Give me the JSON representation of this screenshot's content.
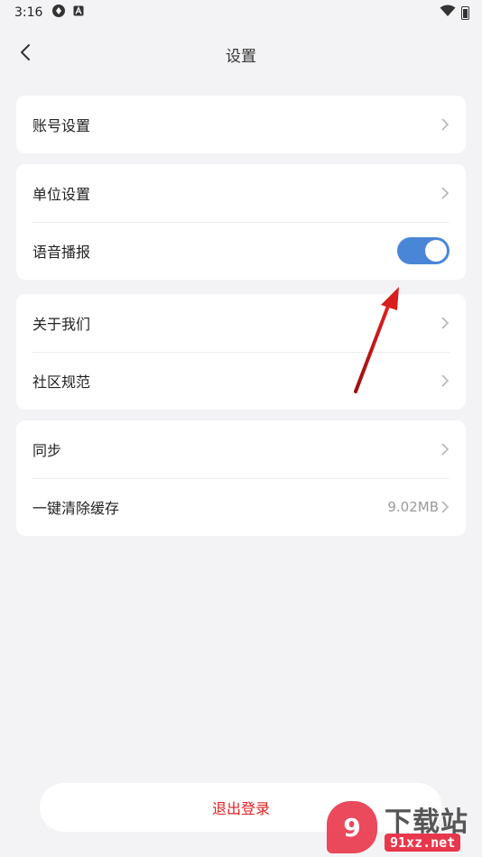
{
  "status_bar": {
    "time": "3:16"
  },
  "nav": {
    "title": "设置"
  },
  "groups": [
    {
      "items": [
        {
          "label": "账号设置"
        }
      ]
    },
    {
      "items": [
        {
          "label": "单位设置"
        },
        {
          "label": "语音播报",
          "toggle_on": true
        }
      ]
    },
    {
      "items": [
        {
          "label": "关于我们"
        },
        {
          "label": "社区规范"
        }
      ]
    },
    {
      "items": [
        {
          "label": "同步"
        },
        {
          "label": "一键清除缓存",
          "value": "9.02MB"
        }
      ]
    }
  ],
  "logout": {
    "label": "退出登录"
  },
  "watermark": {
    "badge": "9",
    "title": "下载站",
    "sub": "91xz.net"
  },
  "colors": {
    "accent": "#4a86d8",
    "danger": "#e02020",
    "background": "#f3f3f5",
    "arrow": "#d81e1e"
  }
}
